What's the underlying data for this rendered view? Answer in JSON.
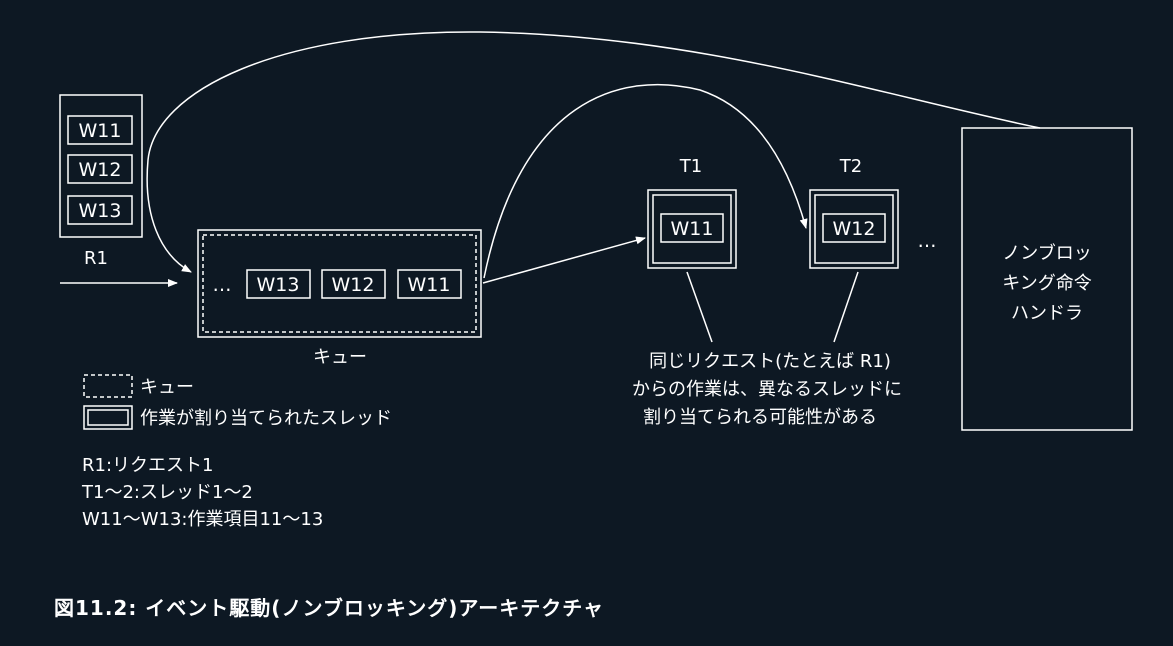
{
  "request_stack": {
    "items": [
      "W11",
      "W12",
      "W13"
    ],
    "label": "R1"
  },
  "queue": {
    "ellipsis": "…",
    "items": [
      "W13",
      "W12",
      "W11"
    ],
    "label": "キュー"
  },
  "threads": [
    {
      "label": "T1",
      "item": "W11"
    },
    {
      "label": "T2",
      "item": "W12"
    }
  ],
  "threads_ellipsis": "…",
  "handler": {
    "lines": [
      "ノンブロッ",
      "キング命令",
      "ハンドラ"
    ]
  },
  "annotation": {
    "lines": [
      "同じリクエスト(たとえば R1)",
      "からの作業は、異なるスレッドに",
      "割り当てられる可能性がある"
    ]
  },
  "legend": {
    "queue_label": "キュー",
    "thread_label": "作業が割り当てられたスレッド",
    "notes": [
      "R1:リクエスト1",
      "T1〜2:スレッド1〜2",
      "W11〜W13:作業項目11〜13"
    ]
  },
  "caption": "図11.2: イベント駆動(ノンブロッキング)アーキテクチャ"
}
